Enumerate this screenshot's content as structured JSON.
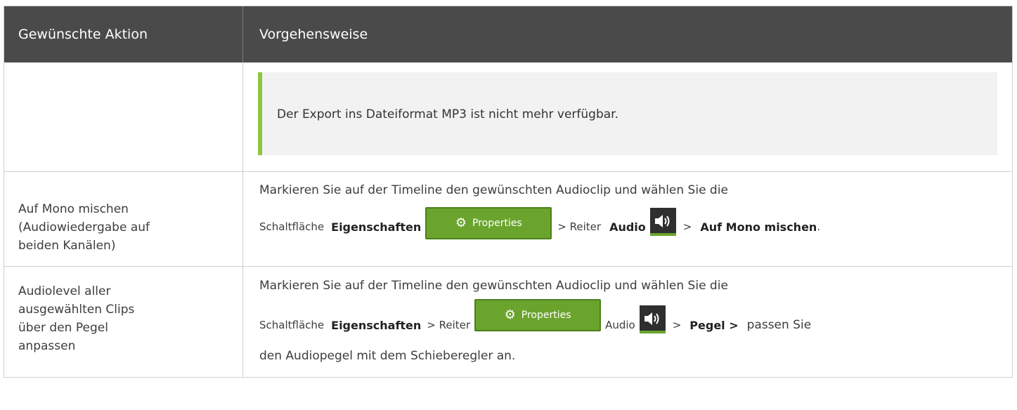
{
  "table": {
    "header": {
      "col1": "Gewünschte Aktion",
      "col2": "Vorgehensweise"
    },
    "note_row": {
      "note_text": "Der Export ins Dateiformat MP3 ist nicht mehr verfügbar."
    },
    "mono_row": {
      "action_lines": [
        "Auf Mono mischen",
        "(Audiowiedergabe auf",
        "beiden Kanälen)"
      ],
      "line1": "Markieren Sie auf der Timeline den gewünschten Audioclip und wählen Sie die",
      "t_button_prefix": "Schaltfläche",
      "t_eigenschaften": "Eigenschaften",
      "t_reiter": "> Reiter",
      "t_audio": "Audio",
      "t_gt": ">",
      "t_mono": "Auf Mono mischen",
      "t_period": "."
    },
    "level_row": {
      "action_lines": [
        "Audiolevel aller",
        "ausgewählten Clips",
        "über den Pegel",
        "anpassen"
      ],
      "line1": "Markieren Sie auf der Timeline den gewünschten Audioclip und wählen Sie die",
      "t_button_prefix": "Schaltfläche",
      "t_eigenschaften": "Eigenschaften",
      "t_reiter": "> Reiter",
      "t_audio": "Audio",
      "t_gt": ">",
      "t_pegel": "Pegel >",
      "t_rest": "passen Sie",
      "line3": "den Audiopegel mit dem Schieberegler an."
    },
    "properties_button_label": "Properties",
    "accent_color": "#8dc63f",
    "button_color": "#6aa42d",
    "header_color": "#4a4a4a"
  }
}
